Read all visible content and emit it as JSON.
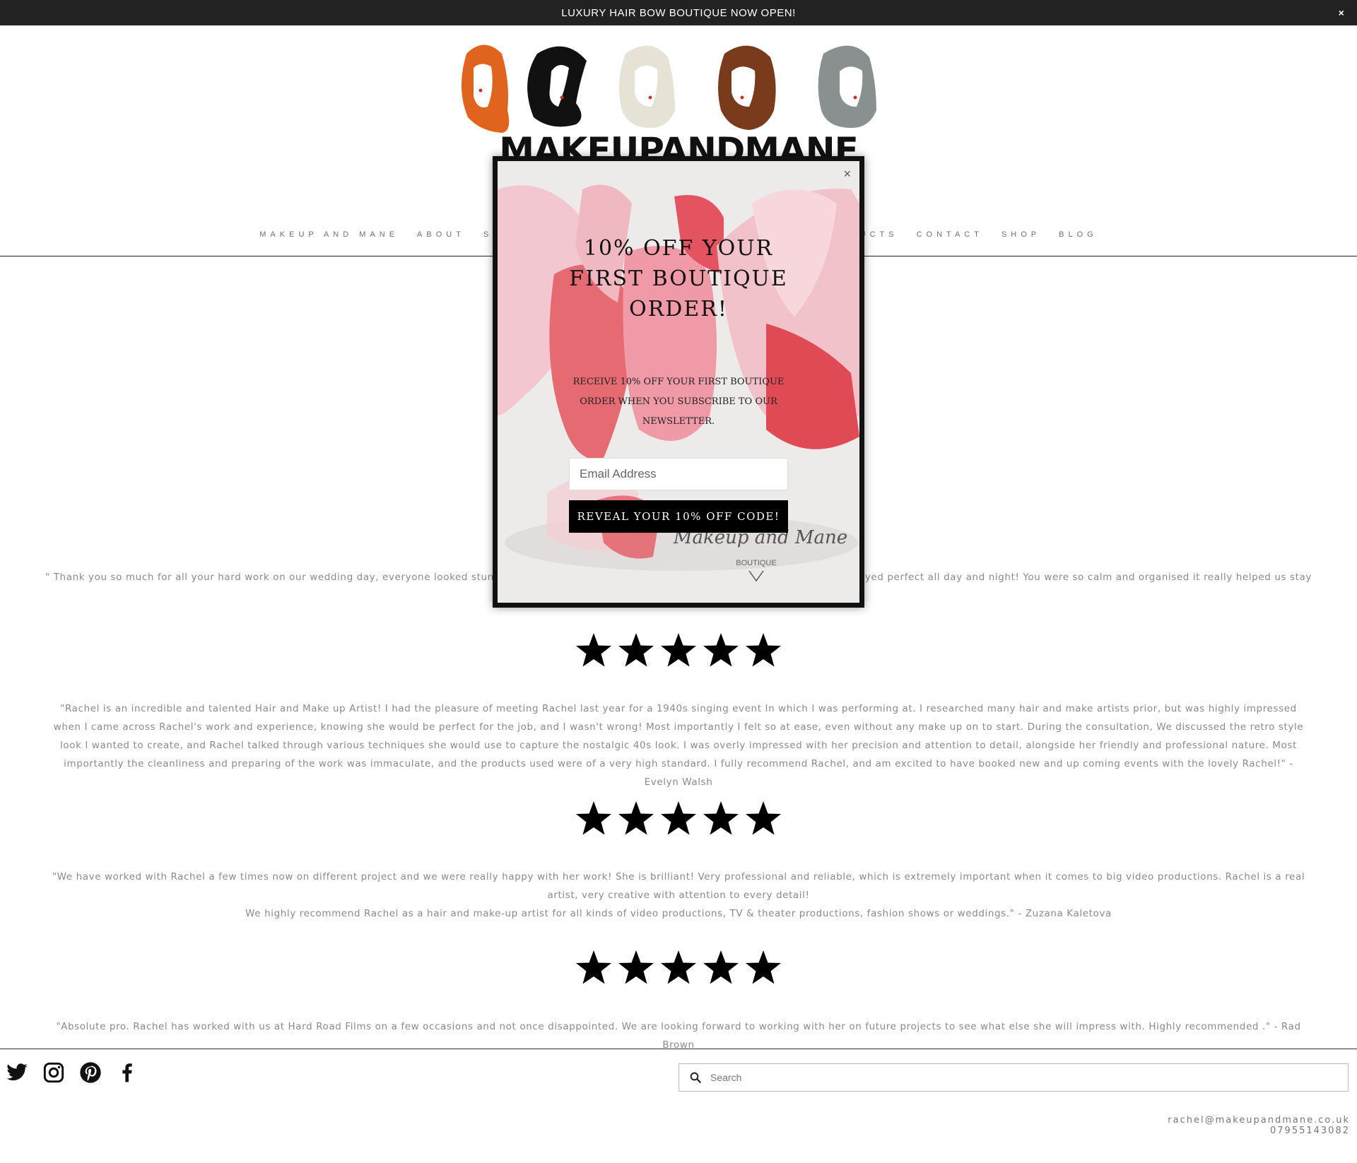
{
  "announcement": {
    "text": "LUXURY HAIR BOW BOUTIQUE NOW OPEN!",
    "close": "×"
  },
  "logo": {
    "alt": "MAKEUPANDMANE"
  },
  "nav": {
    "items": [
      "MAKEUP AND MANE",
      "ABOUT",
      "SE",
      "UCTS",
      "CONTACT",
      "SHOP",
      "BLOG"
    ]
  },
  "reviews": [
    {
      "text": "\" Thank you so much for all your hard work on our wedding day, everyone looked stun",
      "text2": "yed perfect all day and night! You were so calm and organised it really helped us stay"
    },
    {
      "text": "\"Rachel is an incredible and talented Hair and Make up Artist! I had the pleasure of meeting Rachel last year for a 1940s singing event In which I was performing at. I researched many hair and make artists prior, but was highly impressed when I came across Rachel's work and experience, knowing she would be perfect for the job, and I wasn't wrong! Most importantly I felt so at ease, even without any make up on to start. During the consultation, We discussed the retro style look I wanted to create, and Rachel talked through various techniques she would use to capture the nostalgic 40s look. I was overly impressed with her precision and attention to detail, alongside her friendly and professional nature. Most importantly the cleanliness and preparing of the work was immaculate, and the products used were of a very high standard. I fully recommend Rachel, and am excited to have booked new and up coming events with the lovely Rachel!\" - Evelyn Walsh"
    },
    {
      "text": "\"We have worked with Rachel a few times now on different project and we were really happy with her work! She is brilliant! Very professional and reliable, which is extremely important when it comes to big video productions. Rachel is a real artist, very creative with attention to every detail!",
      "text2": "We highly recommend Rachel as a hair and make-up artist for all kinds of video productions, TV & theater productions, fashion shows or weddings.\" - Zuzana Kaletova"
    },
    {
      "text": "\"Absolute pro. Rachel has worked with us at Hard Road Films on a few occasions and not once disappointed. We are looking forward to working with her on future projects to see what else she will impress with. Highly recommended .\" - Rad Brown"
    }
  ],
  "footer": {
    "social": [
      "twitter-icon",
      "instagram-icon",
      "pinterest-icon",
      "facebook-icon"
    ],
    "search_placeholder": "Search",
    "email": "rachel@makeupandmane.co.uk",
    "phone": "07955143082"
  },
  "modal": {
    "close": "×",
    "title": "10% OFF YOUR FIRST BOUTIQUE ORDER!",
    "text": "RECEIVE 10% OFF YOUR FIRST BOUTIQUE ORDER WHEN YOU SUBSCRIBE TO OUR NEWSLETTER.",
    "email_placeholder": "Email Address",
    "button": "REVEAL YOUR 10% OFF CODE!",
    "brand_script": "Makeup and Mane",
    "brand_sub": "BOUTIQUE"
  },
  "colors": {
    "bar": "#222222",
    "accent": "#000000",
    "bow": "#e8454c"
  }
}
